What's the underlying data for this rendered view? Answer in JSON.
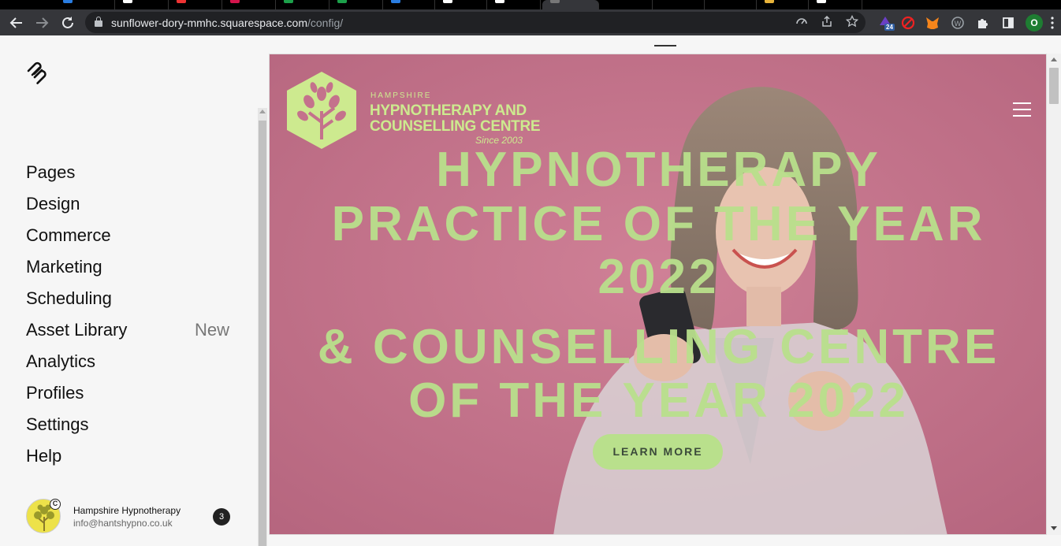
{
  "browser": {
    "url_host": "sunflower-dory-mmhc.squarespace.com",
    "url_path": "/config/",
    "profile_initial": "O",
    "extension_badge": "24"
  },
  "sidebar": {
    "items": [
      {
        "label": "Pages"
      },
      {
        "label": "Design"
      },
      {
        "label": "Commerce"
      },
      {
        "label": "Marketing"
      },
      {
        "label": "Scheduling"
      },
      {
        "label": "Asset Library",
        "badge": "New"
      },
      {
        "label": "Analytics"
      },
      {
        "label": "Profiles"
      },
      {
        "label": "Settings"
      },
      {
        "label": "Help"
      }
    ],
    "account": {
      "name": "Hampshire Hypnotherapy",
      "email": "info@hantshypno.co.uk",
      "notifications": "3"
    }
  },
  "site": {
    "logo": {
      "line1": "HAMPSHIRE",
      "line2": "HYPNOTHERAPY AND",
      "line3": "COUNSELLING CENTRE",
      "tagline": "Since 2003"
    },
    "headline": {
      "line1": "HYPNOTHERAPY",
      "line2": "PRACTICE OF THE YEAR",
      "line3": "2022",
      "line4": "& COUNSELLING CENTRE",
      "line5": "OF THE YEAR 2022"
    },
    "cta_label": "LEARN MORE",
    "colors": {
      "accent": "#b9e08c",
      "background": "#c4728c"
    }
  }
}
